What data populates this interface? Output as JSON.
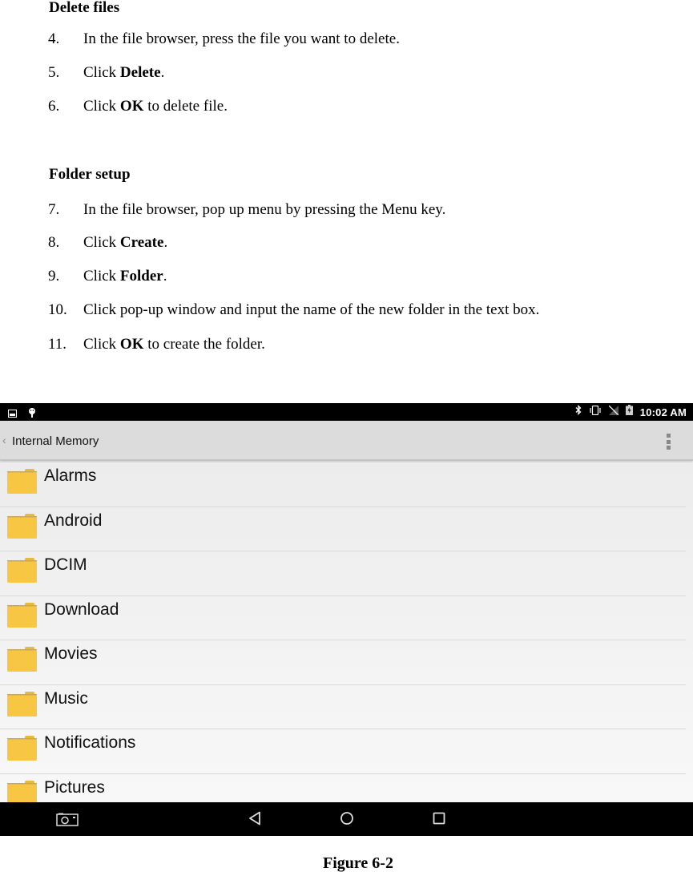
{
  "document": {
    "section_delete": {
      "heading": "Delete files",
      "steps": [
        {
          "num": "4.",
          "pre": "In the file browser, press the file you want to delete.",
          "bold": "",
          "post": ""
        },
        {
          "num": "5.",
          "pre": "Click ",
          "bold": "Delete",
          "post": "."
        },
        {
          "num": "6.",
          "pre": "Click ",
          "bold": "OK",
          "post": " to delete file."
        }
      ]
    },
    "section_folder": {
      "heading": "Folder setup",
      "steps": [
        {
          "num": "7.",
          "pre": "In the file browser, pop up menu by pressing the Menu key.",
          "bold": "",
          "post": ""
        },
        {
          "num": "8.",
          "pre": "Click ",
          "bold": "Create",
          "post": "."
        },
        {
          "num": "9.",
          "pre": "Click ",
          "bold": "Folder",
          "post": "."
        },
        {
          "num": "10.",
          "pre": "Click pop-up window and input the name of the new folder in the text box.",
          "bold": "",
          "post": ""
        },
        {
          "num": "11.",
          "pre": "Click ",
          "bold": "OK",
          "post": " to create the folder."
        }
      ]
    },
    "caption": "Figure 6-2"
  },
  "phone": {
    "status_bar": {
      "left_icons": [
        "image-notification-icon",
        "android-debug-icon"
      ],
      "right_icons": [
        "bluetooth-icon",
        "vibrate-icon",
        "no-signal-icon",
        "battery-charging-icon"
      ],
      "time": "10:02 AM"
    },
    "action_bar": {
      "back_glyph": "‹",
      "title": "Internal Memory",
      "overflow_icon": "overflow-menu-icon"
    },
    "file_list": {
      "items": [
        {
          "name": "Alarms",
          "icon": "folder-icon"
        },
        {
          "name": "Android",
          "icon": "folder-icon"
        },
        {
          "name": "DCIM",
          "icon": "folder-icon"
        },
        {
          "name": "Download",
          "icon": "folder-icon"
        },
        {
          "name": "Movies",
          "icon": "folder-icon"
        },
        {
          "name": "Music",
          "icon": "folder-icon"
        },
        {
          "name": "Notifications",
          "icon": "folder-icon"
        },
        {
          "name": "Pictures",
          "icon": "folder-icon"
        }
      ]
    },
    "nav_bar": {
      "buttons": [
        "screenshot",
        "back",
        "home",
        "recents"
      ]
    },
    "colors": {
      "folder": "#f7c744",
      "folder_tab": "#e8b93a",
      "action_bar": "#dcdcdc",
      "status_bar": "#000000"
    }
  }
}
